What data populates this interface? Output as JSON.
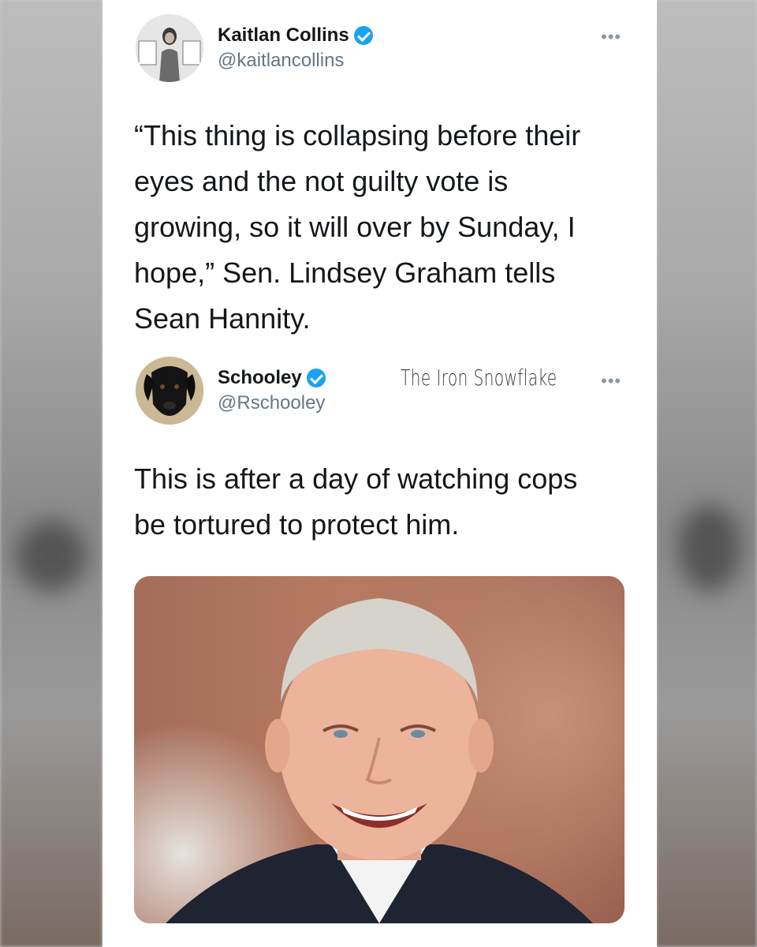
{
  "tweet1": {
    "name": "Kaitlan Collins",
    "handle": "@kaitlancollins",
    "more": "•••",
    "lines": [
      "“This thing is collapsing before their",
      "eyes and the not guilty vote is",
      "growing, so it will over by Sunday, I",
      "hope,” Sen. Lindsey Graham tells",
      "Sean Hannity."
    ]
  },
  "tweet2": {
    "name": "Schooley",
    "handle": "@Rschooley",
    "more": "•••",
    "lines": [
      "This is after a day of watching cops",
      "be tortured to protect him."
    ]
  },
  "watermark": "The Iron Snowflake",
  "colors": {
    "verified": "#1da1f2",
    "name": "#14171a",
    "handle": "#657786"
  },
  "icons": {
    "verified": "verified-badge-icon",
    "more": "more-options-icon"
  }
}
